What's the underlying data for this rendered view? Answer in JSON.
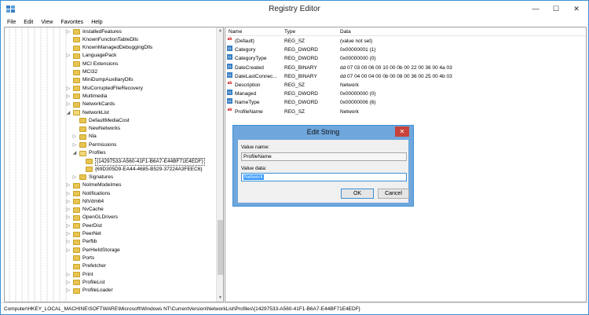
{
  "window": {
    "title": "Registry Editor"
  },
  "menu": [
    "File",
    "Edit",
    "View",
    "Favorites",
    "Help"
  ],
  "tree": {
    "items": [
      {
        "label": "InstalledFeatures",
        "level": 0,
        "expander": "▷",
        "open": false
      },
      {
        "label": "KnownFunctionTableDlls",
        "level": 0,
        "expander": "",
        "open": false
      },
      {
        "label": "KnownManagedDebuggingDlls",
        "level": 0,
        "expander": "",
        "open": false
      },
      {
        "label": "LanguagePack",
        "level": 0,
        "expander": "▷",
        "open": false
      },
      {
        "label": "MCI Extensions",
        "level": 0,
        "expander": "",
        "open": false
      },
      {
        "label": "MCI32",
        "level": 0,
        "expander": "",
        "open": false
      },
      {
        "label": "MiniDumpAuxiliaryDlls",
        "level": 0,
        "expander": "",
        "open": false
      },
      {
        "label": "MsiCorruptedFileRecovery",
        "level": 0,
        "expander": "▷",
        "open": false
      },
      {
        "label": "Multimedia",
        "level": 0,
        "expander": "▷",
        "open": false
      },
      {
        "label": "NetworkCards",
        "level": 0,
        "expander": "▷",
        "open": false
      },
      {
        "label": "NetworkList",
        "level": 0,
        "expander": "◢",
        "open": true
      },
      {
        "label": "DefaultMediaCost",
        "level": 1,
        "expander": "",
        "open": false
      },
      {
        "label": "NewNetworks",
        "level": 1,
        "expander": "",
        "open": false
      },
      {
        "label": "Nla",
        "level": 1,
        "expander": "▷",
        "open": false
      },
      {
        "label": "Permissions",
        "level": 1,
        "expander": "▷",
        "open": false
      },
      {
        "label": "Profiles",
        "level": 1,
        "expander": "◢",
        "open": true
      },
      {
        "label": "{14297533-A560-41F1-B6A7-E44BF71E4EDF}",
        "level": 2,
        "expander": "",
        "open": false,
        "selected": true
      },
      {
        "label": "{69D305D9-EA44-4685-B529-37224A3FEEC6}",
        "level": 2,
        "expander": "",
        "open": false
      },
      {
        "label": "Signatures",
        "level": 1,
        "expander": "▷",
        "open": false
      },
      {
        "label": "NoImeModeImes",
        "level": 0,
        "expander": "▷",
        "open": false
      },
      {
        "label": "Notifications",
        "level": 0,
        "expander": "▷",
        "open": false
      },
      {
        "label": "NtVdm64",
        "level": 0,
        "expander": "▷",
        "open": false
      },
      {
        "label": "NvCache",
        "level": 0,
        "expander": "▷",
        "open": false
      },
      {
        "label": "OpenGLDrivers",
        "level": 0,
        "expander": "▷",
        "open": false
      },
      {
        "label": "PeerDist",
        "level": 0,
        "expander": "▷",
        "open": false
      },
      {
        "label": "PeerNet",
        "level": 0,
        "expander": "▷",
        "open": false
      },
      {
        "label": "Perflib",
        "level": 0,
        "expander": "▷",
        "open": false
      },
      {
        "label": "PerHwIdStorage",
        "level": 0,
        "expander": "▷",
        "open": false
      },
      {
        "label": "Ports",
        "level": 0,
        "expander": "",
        "open": false
      },
      {
        "label": "Prefetcher",
        "level": 0,
        "expander": "",
        "open": false
      },
      {
        "label": "Print",
        "level": 0,
        "expander": "▷",
        "open": false
      },
      {
        "label": "ProfileList",
        "level": 0,
        "expander": "▷",
        "open": false
      },
      {
        "label": "ProfileLoader",
        "level": 0,
        "expander": "▷",
        "open": false
      }
    ]
  },
  "values": {
    "columns": {
      "name": "Name",
      "type": "Type",
      "data": "Data"
    },
    "rows": [
      {
        "name": "(Default)",
        "type": "REG_SZ",
        "data": "(value not set)",
        "icon": "ab"
      },
      {
        "name": "Category",
        "type": "REG_DWORD",
        "data": "0x00000001 (1)",
        "icon": "bin"
      },
      {
        "name": "CategoryType",
        "type": "REG_DWORD",
        "data": "0x00000000 (0)",
        "icon": "bin"
      },
      {
        "name": "DateCreated",
        "type": "REG_BINARY",
        "data": "dd 07 03 00 06 00 10 00 0b 00 22 00 36 00 4a 03",
        "icon": "bin"
      },
      {
        "name": "DateLastConnec...",
        "type": "REG_BINARY",
        "data": "dd 07 04 00 04 00 0b 00 08 00 36 00 25 00 4b 03",
        "icon": "bin"
      },
      {
        "name": "Description",
        "type": "REG_SZ",
        "data": "Network",
        "icon": "ab"
      },
      {
        "name": "Managed",
        "type": "REG_DWORD",
        "data": "0x00000000 (0)",
        "icon": "bin"
      },
      {
        "name": "NameType",
        "type": "REG_DWORD",
        "data": "0x00000006 (6)",
        "icon": "bin"
      },
      {
        "name": "ProfileName",
        "type": "REG_SZ",
        "data": "Network",
        "icon": "ab"
      }
    ]
  },
  "dialog": {
    "title": "Edit String",
    "value_name_label": "Value name:",
    "value_name": "ProfileName",
    "value_data_label": "Value data:",
    "value_data": "Network",
    "ok_label": "OK",
    "cancel_label": "Cancel"
  },
  "status_path": "Computer\\HKEY_LOCAL_MACHINE\\SOFTWARE\\Microsoft\\Windows NT\\CurrentVersion\\NetworkList\\Profiles\\{14297533-A560-41F1-B6A7-E44BF71E4EDF}",
  "colors": {
    "accent": "#3c8fd6",
    "close": "#c7423a",
    "folder": "#e8c552",
    "selection": "#3399ff"
  }
}
